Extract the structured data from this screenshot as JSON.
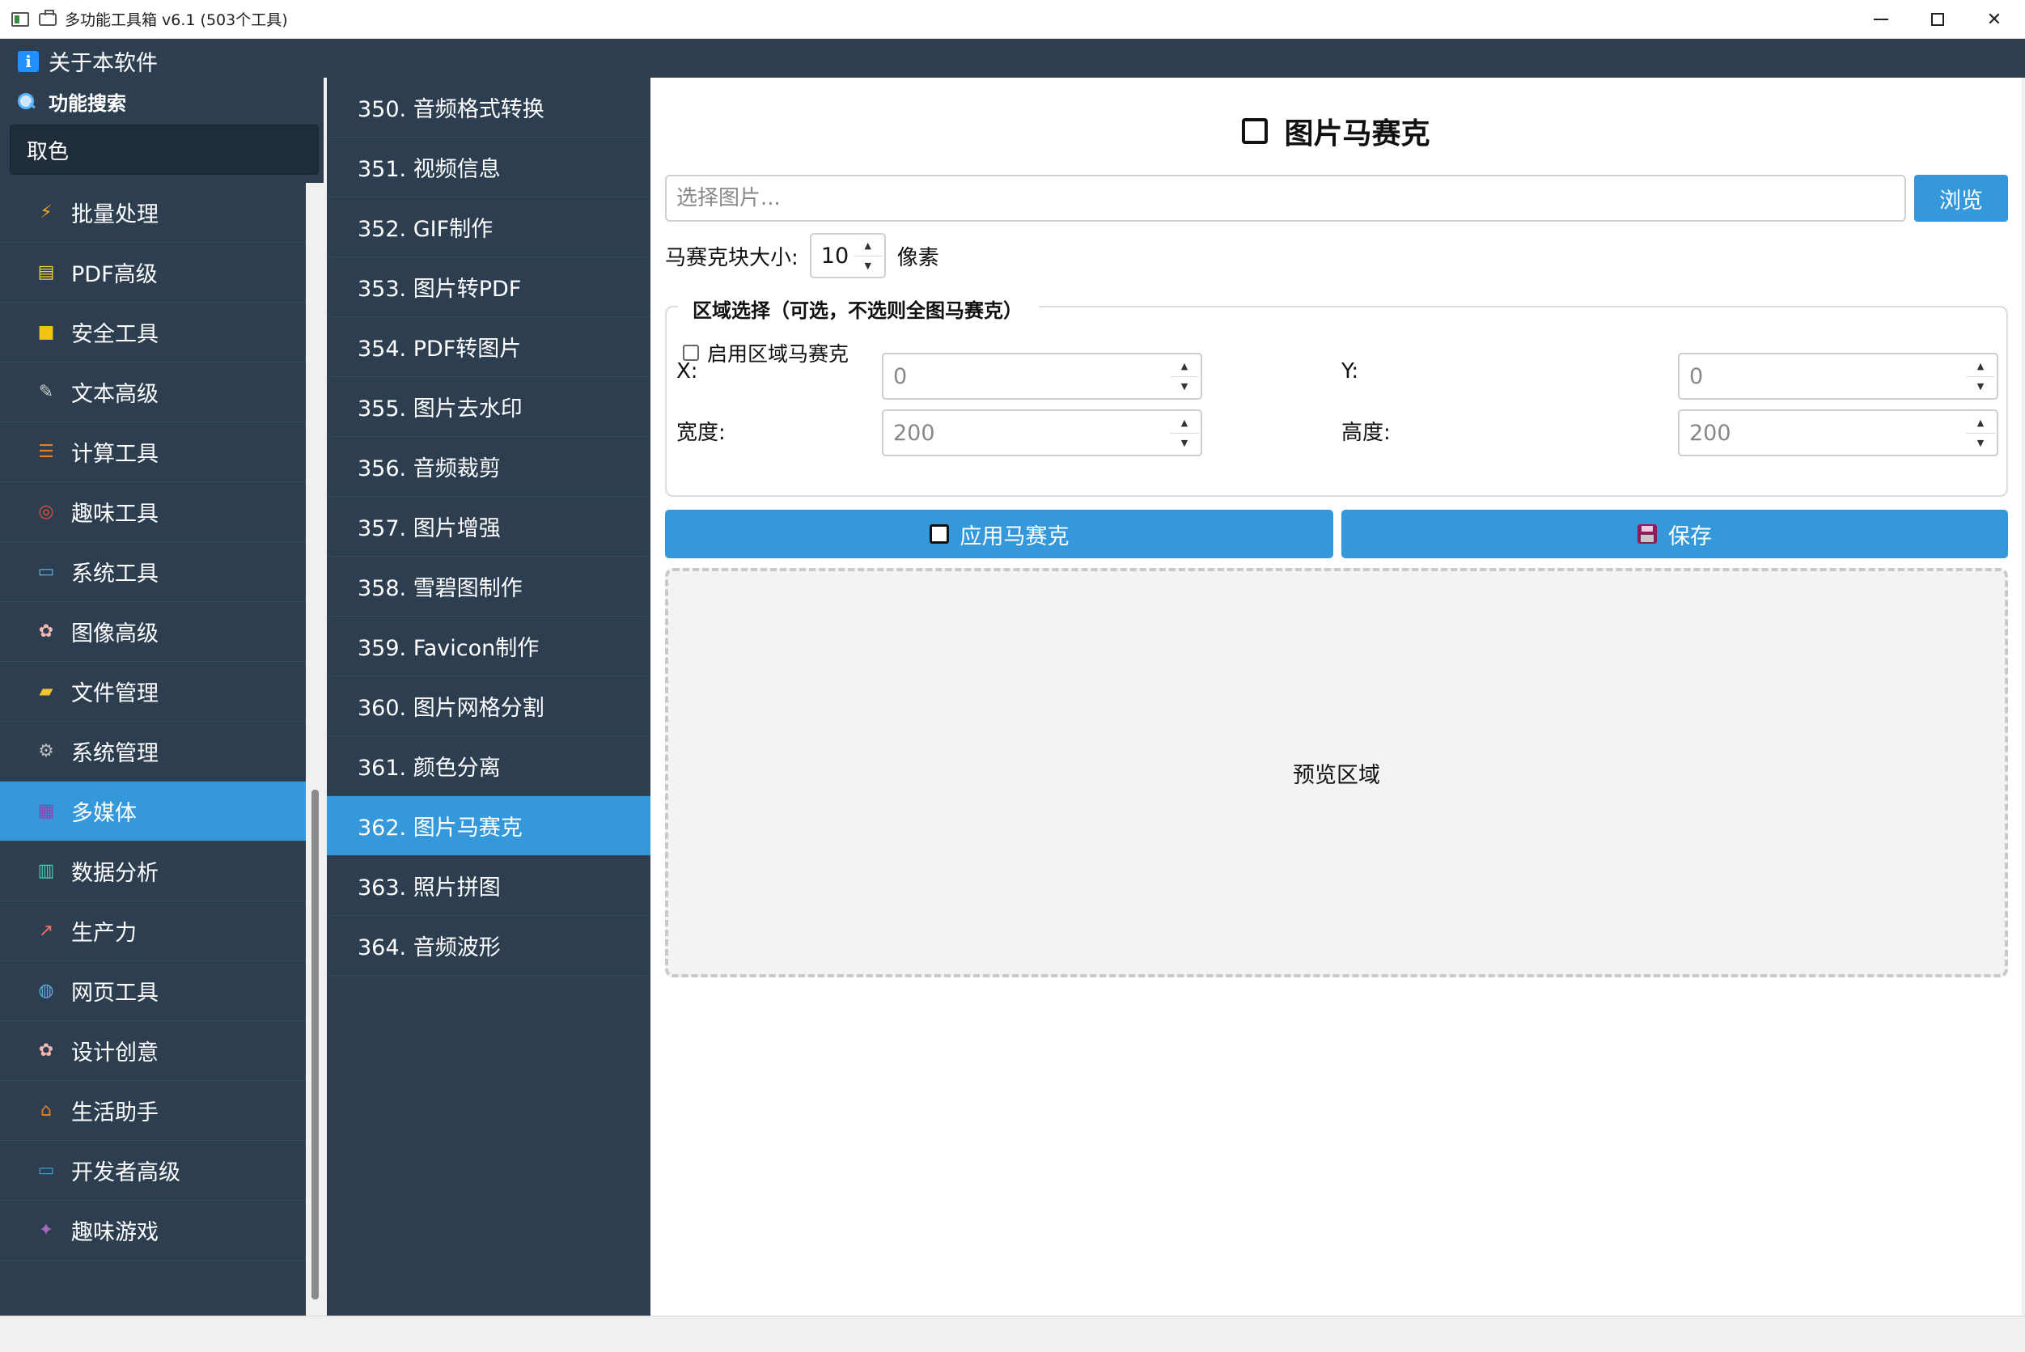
{
  "window": {
    "title": "多功能工具箱 v6.1 (503个工具)",
    "controls": [
      "minimize",
      "maximize",
      "close"
    ]
  },
  "menu": {
    "about_label": "关于本软件"
  },
  "sidebar": {
    "search_label": "功能搜索",
    "search_value": "取色",
    "items": [
      {
        "label": "批量处理",
        "icon": "lightning-icon"
      },
      {
        "label": "PDF高级",
        "icon": "clipboard-icon"
      },
      {
        "label": "安全工具",
        "icon": "lock-icon"
      },
      {
        "label": "文本高级",
        "icon": "pencil-icon"
      },
      {
        "label": "计算工具",
        "icon": "abacus-icon"
      },
      {
        "label": "趣味工具",
        "icon": "target-icon"
      },
      {
        "label": "系统工具",
        "icon": "monitor-icon"
      },
      {
        "label": "图像高级",
        "icon": "palette-icon"
      },
      {
        "label": "文件管理",
        "icon": "folder-icon"
      },
      {
        "label": "系统管理",
        "icon": "gear-icon"
      },
      {
        "label": "多媒体",
        "icon": "clapper-icon",
        "active": true
      },
      {
        "label": "数据分析",
        "icon": "bar-chart-icon"
      },
      {
        "label": "生产力",
        "icon": "line-chart-icon"
      },
      {
        "label": "网页工具",
        "icon": "globe-icon"
      },
      {
        "label": "设计创意",
        "icon": "palette-icon"
      },
      {
        "label": "生活助手",
        "icon": "house-icon"
      },
      {
        "label": "开发者高级",
        "icon": "laptop-icon"
      },
      {
        "label": "趣味游戏",
        "icon": "alien-icon"
      }
    ]
  },
  "tools": [
    {
      "label": "350. 音频格式转换"
    },
    {
      "label": "351. 视频信息"
    },
    {
      "label": "352. GIF制作"
    },
    {
      "label": "353. 图片转PDF"
    },
    {
      "label": "354. PDF转图片"
    },
    {
      "label": "355. 图片去水印"
    },
    {
      "label": "356. 音频裁剪"
    },
    {
      "label": "357. 图片增强"
    },
    {
      "label": "358. 雪碧图制作"
    },
    {
      "label": "359. Favicon制作"
    },
    {
      "label": "360. 图片网格分割"
    },
    {
      "label": "361. 颜色分离"
    },
    {
      "label": "362. 图片马赛克",
      "active": true
    },
    {
      "label": "363. 照片拼图"
    },
    {
      "label": "364. 音频波形"
    }
  ],
  "main": {
    "title": "图片马赛克",
    "file_placeholder": "选择图片...",
    "browse_label": "浏览",
    "block_size_label": "马赛克块大小:",
    "block_size_value": "10",
    "block_size_unit": "像素",
    "region": {
      "legend": "区域选择（可选，不选则全图马赛克）",
      "enable_label": "启用区域马赛克",
      "enabled": false,
      "x_label": "X:",
      "x_value": "0",
      "y_label": "Y:",
      "y_value": "0",
      "width_label": "宽度:",
      "width_value": "200",
      "height_label": "高度:",
      "height_value": "200"
    },
    "apply_label": "应用马赛克",
    "save_label": "保存",
    "preview_label": "预览区域"
  },
  "colors": {
    "sidebar_bg": "#2c3e50",
    "accent": "#3498db",
    "panel_bg": "#ffffff"
  }
}
